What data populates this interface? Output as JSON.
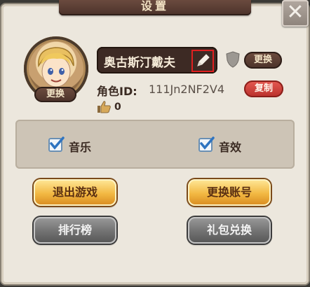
{
  "dialog": {
    "title": "设置",
    "close_symbol": "✕"
  },
  "profile": {
    "avatar_icon": "hero-avatar-icon",
    "avatar_change_label": "更换",
    "player_name": "奥古斯汀戴夫",
    "edit_icon": "pencil-icon",
    "badge_icon": "shield-icon",
    "change_label": "更换",
    "role_id_label": "角色ID:",
    "role_id_value": "111Jn2NF2V4",
    "copy_label": "复制",
    "like_icon": "thumbs-up-icon",
    "like_count": "0"
  },
  "sound": {
    "music_label": "音乐",
    "music_checked": true,
    "sfx_label": "音效",
    "sfx_checked": true
  },
  "actions": {
    "logout_label": "退出游戏",
    "switch_account_label": "更换账号",
    "leaderboard_label": "排行榜",
    "gift_redeem_label": "礼包兑换"
  },
  "colors": {
    "highlight_border": "#e02020",
    "gold_button": "#f2b842",
    "gray_button": "#6e6e6e",
    "copy_button": "#c63a33"
  }
}
